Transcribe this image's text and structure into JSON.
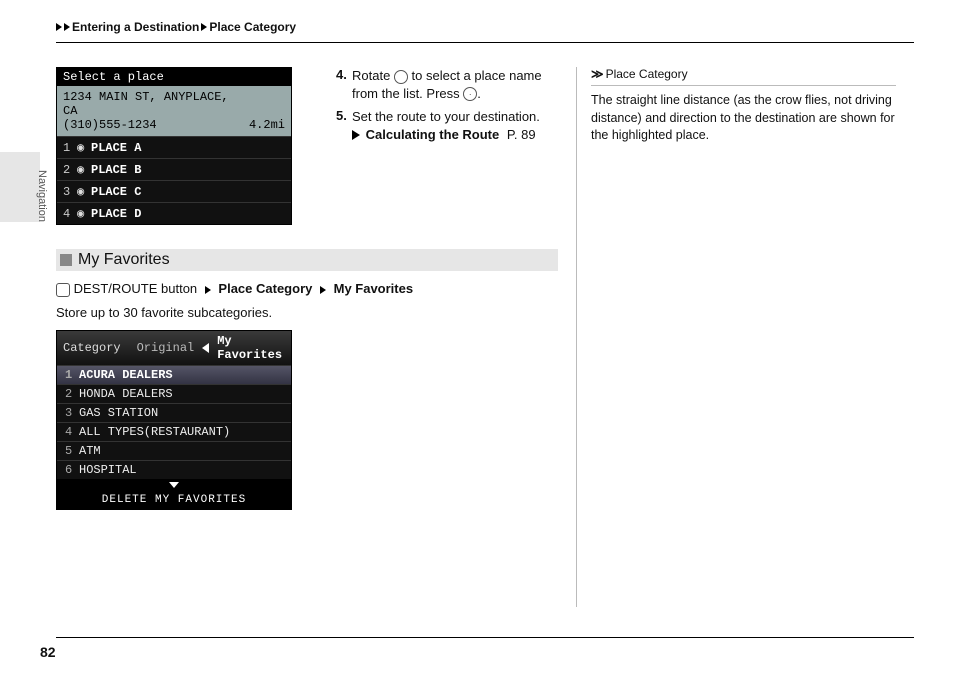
{
  "breadcrumb": {
    "a": "Entering a Destination",
    "b": "Place Category"
  },
  "sidebar": {
    "label": "Navigation"
  },
  "figure1": {
    "header": "Select a place",
    "address": "1234 MAIN ST, ANYPLACE, CA",
    "phone": "(310)555-1234",
    "distance": "4.2mi",
    "rows": [
      {
        "n": "1",
        "name": "PLACE A"
      },
      {
        "n": "2",
        "name": "PLACE B"
      },
      {
        "n": "3",
        "name": "PLACE C"
      },
      {
        "n": "4",
        "name": "PLACE D"
      }
    ]
  },
  "steps": {
    "s4_n": "4.",
    "s4_a": "Rotate ",
    "s4_b": " to select a place name from the list. Press ",
    "s4_c": ".",
    "s5_n": "5.",
    "s5_a": "Set the route to your destination.",
    "xref_label": "Calculating the Route",
    "xref_page": "P. 89"
  },
  "section": {
    "title": "My Favorites",
    "path_a": "DEST/ROUTE button",
    "path_b": "Place Category",
    "path_c": "My Favorites",
    "desc": "Store up to 30 favorite subcategories."
  },
  "figure2": {
    "label": "Category",
    "tab_a": "Original",
    "tab_b": "My Favorites",
    "items": [
      {
        "n": "1",
        "name": "ACURA DEALERS"
      },
      {
        "n": "2",
        "name": "HONDA DEALERS"
      },
      {
        "n": "3",
        "name": "GAS STATION"
      },
      {
        "n": "4",
        "name": "ALL TYPES(RESTAURANT)"
      },
      {
        "n": "5",
        "name": "ATM"
      },
      {
        "n": "6",
        "name": "HOSPITAL"
      }
    ],
    "footer": "DELETE MY FAVORITES"
  },
  "tip": {
    "title": "Place Category",
    "body": "The straight line distance (as the crow flies, not driving distance) and direction to the destination are shown for the highlighted place."
  },
  "page_number": "82"
}
